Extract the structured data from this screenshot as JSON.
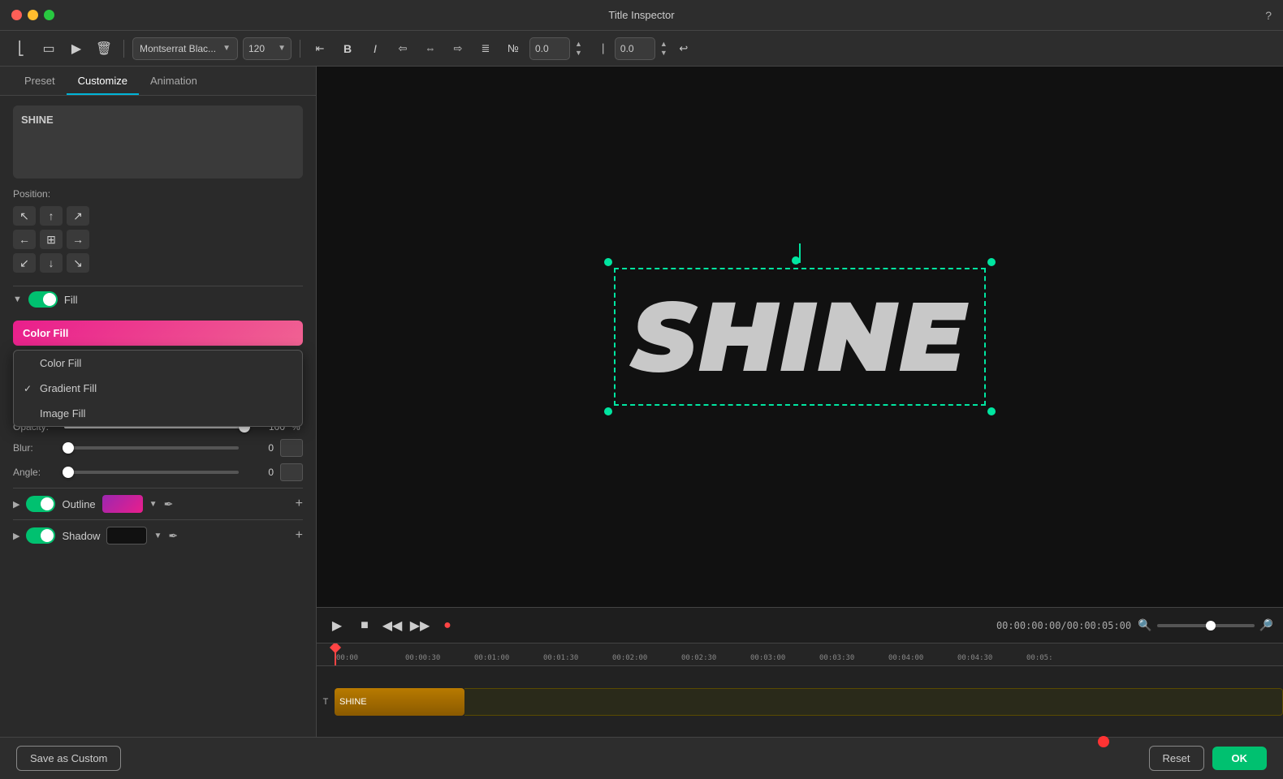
{
  "titleBar": {
    "title": "Title Inspector",
    "helpIcon": "?"
  },
  "toolbar": {
    "fontName": "Montserrat Blac...",
    "fontSize": "120",
    "numericVal1": "0.0",
    "numericVal2": "0.0",
    "icons": [
      "text-icon",
      "frame-icon",
      "media-icon",
      "trash-icon",
      "align-left-icon",
      "bold-icon",
      "italic-icon",
      "align-para-icon",
      "align-center-icon",
      "align-right-icon",
      "justify-icon",
      "strikethrough-icon",
      "tracking-icon"
    ]
  },
  "leftPanel": {
    "tabs": [
      {
        "id": "preset",
        "label": "Preset"
      },
      {
        "id": "customize",
        "label": "Customize",
        "active": true
      },
      {
        "id": "animation",
        "label": "Animation"
      }
    ],
    "previewLabel": "SHINE",
    "positionLabel": "Position:",
    "positionButtons": [
      "↖",
      "↑",
      "↗",
      "←",
      "↔",
      "→",
      "↙",
      "↓",
      "↘"
    ],
    "fillSection": {
      "label": "Fill",
      "enabled": true,
      "dropdownOptions": [
        {
          "id": "color-fill",
          "label": "Color Fill",
          "selected": false
        },
        {
          "id": "gradient-fill",
          "label": "Gradient Fill",
          "selected": true
        },
        {
          "id": "image-fill",
          "label": "Image Fill",
          "selected": false
        }
      ],
      "currentSelection": "Color Fill",
      "opacityLabel": "Opacity:",
      "opacityValue": "100",
      "opacityUnit": "%",
      "blurLabel": "Blur:",
      "blurValue": "0",
      "angleLabel": "Angle:",
      "angleValue": "0"
    },
    "outlineSection": {
      "label": "Outline",
      "enabled": true
    },
    "shadowSection": {
      "label": "Shadow",
      "enabled": true
    }
  },
  "preview": {
    "text": "SHINE"
  },
  "timeline": {
    "timeDisplay": "00:00:00:00/00:00:05:00",
    "clipLabel": "SHINE",
    "rulerMarks": [
      "00:00",
      "00:00:30",
      "00:01:00",
      "00:01:30",
      "00:02:00",
      "00:02:30",
      "00:03:00",
      "00:03:30",
      "00:04:00",
      "00:04:30",
      "00:05:"
    ]
  },
  "bottomBar": {
    "saveCustomLabel": "Save as Custom",
    "resetLabel": "Reset",
    "okLabel": "OK"
  }
}
